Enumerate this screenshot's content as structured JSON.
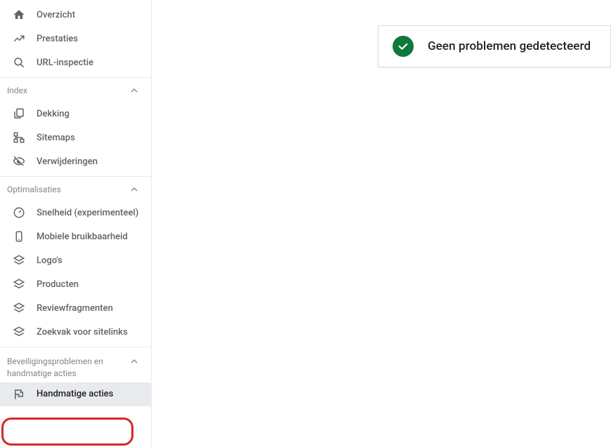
{
  "sidebar": {
    "top": [
      {
        "icon": "home",
        "label": "Overzicht"
      },
      {
        "icon": "trending",
        "label": "Prestaties"
      },
      {
        "icon": "search",
        "label": "URL-inspectie"
      }
    ],
    "sections": [
      {
        "title": "Index",
        "items": [
          {
            "icon": "coverage",
            "label": "Dekking"
          },
          {
            "icon": "sitemap",
            "label": "Sitemaps"
          },
          {
            "icon": "remove",
            "label": "Verwijderingen"
          }
        ]
      },
      {
        "title": "Optimalisaties",
        "items": [
          {
            "icon": "speed",
            "label": "Snelheid (experimenteel)"
          },
          {
            "icon": "mobile",
            "label": "Mobiele bruikbaarheid"
          },
          {
            "icon": "layers",
            "label": "Logo's"
          },
          {
            "icon": "layers",
            "label": "Producten"
          },
          {
            "icon": "layers",
            "label": "Reviewfragmenten"
          },
          {
            "icon": "layers",
            "label": "Zoekvak voor sitelinks"
          }
        ]
      },
      {
        "title": "Beveiligingsproblemen en handmatige acties",
        "items": [
          {
            "icon": "flag",
            "label": "Handmatige acties",
            "selected": true
          }
        ]
      }
    ]
  },
  "status": {
    "message": "Geen problemen gedetecteerd"
  }
}
